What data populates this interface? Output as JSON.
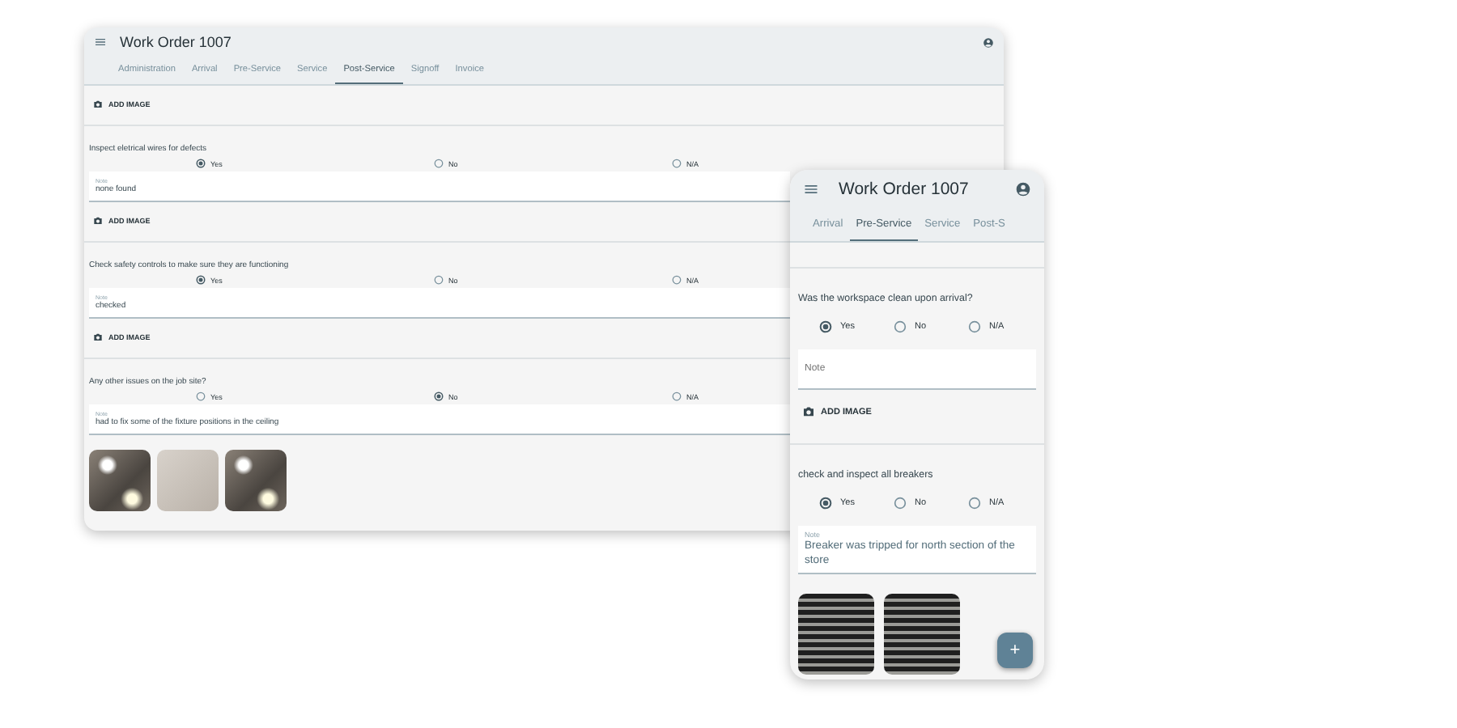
{
  "screens": [
    {
      "kind": "desktop",
      "title": "Work Order 1007",
      "tabs": [
        {
          "label": "Administration",
          "selected": false
        },
        {
          "label": "Arrival",
          "selected": false
        },
        {
          "label": "Pre-Service",
          "selected": false
        },
        {
          "label": "Service",
          "selected": false
        },
        {
          "label": "Post-Service",
          "selected": true
        },
        {
          "label": "Signoff",
          "selected": false
        },
        {
          "label": "Invoice",
          "selected": false
        }
      ],
      "items": [
        {
          "kind": "add_image",
          "label": "ADD IMAGE"
        },
        {
          "kind": "divider"
        },
        {
          "kind": "question",
          "text": "Inspect eletrical wires for defects",
          "options": [
            {
              "label": "Yes",
              "selected": true
            },
            {
              "label": "No",
              "selected": false
            },
            {
              "label": "N/A",
              "selected": false
            }
          ],
          "note": {
            "label": "Note",
            "value": "none found"
          }
        },
        {
          "kind": "add_image",
          "label": "ADD IMAGE"
        },
        {
          "kind": "divider"
        },
        {
          "kind": "question",
          "text": "Check safety controls to make sure they are functioning",
          "options": [
            {
              "label": "Yes",
              "selected": true
            },
            {
              "label": "No",
              "selected": false
            },
            {
              "label": "N/A",
              "selected": false
            }
          ],
          "note": {
            "label": "Note",
            "value": "checked"
          }
        },
        {
          "kind": "add_image",
          "label": "ADD IMAGE"
        },
        {
          "kind": "divider"
        },
        {
          "kind": "question",
          "text": "Any other issues on the job site?",
          "options": [
            {
              "label": "Yes",
              "selected": false
            },
            {
              "label": "No",
              "selected": true
            },
            {
              "label": "N/A",
              "selected": false
            }
          ],
          "note": {
            "label": "Note",
            "value": "had to fix some of the fixture positions in the ceiling"
          }
        },
        {
          "kind": "photos",
          "photos": [
            {
              "kind": "ceiling"
            },
            {
              "kind": "plain"
            },
            {
              "kind": "ceiling"
            }
          ]
        }
      ]
    },
    {
      "kind": "phone",
      "title": "Work Order 1007",
      "tabs": [
        {
          "label": "Arrival",
          "selected": false
        },
        {
          "label": "Pre-Service",
          "selected": true
        },
        {
          "label": "Service",
          "selected": false
        },
        {
          "label": "Post-S",
          "selected": false
        }
      ],
      "items": [
        {
          "kind": "divider"
        },
        {
          "kind": "question",
          "text": "Was the workspace clean upon arrival?",
          "options": [
            {
              "label": "Yes",
              "selected": true
            },
            {
              "label": "No",
              "selected": false
            },
            {
              "label": "N/A",
              "selected": false
            }
          ],
          "note": {
            "placeholder": "Note"
          }
        },
        {
          "kind": "add_image",
          "label": "ADD IMAGE"
        },
        {
          "kind": "divider"
        },
        {
          "kind": "question",
          "text": "check and inspect all breakers",
          "options": [
            {
              "label": "Yes",
              "selected": true
            },
            {
              "label": "No",
              "selected": false
            },
            {
              "label": "N/A",
              "selected": false
            }
          ],
          "note": {
            "label": "Note",
            "value": "Breaker was tripped for north section of the store"
          }
        },
        {
          "kind": "photos",
          "photos": [
            {
              "kind": "breaker"
            },
            {
              "kind": "breaker"
            }
          ]
        }
      ],
      "fab": {
        "label": "+"
      }
    }
  ]
}
